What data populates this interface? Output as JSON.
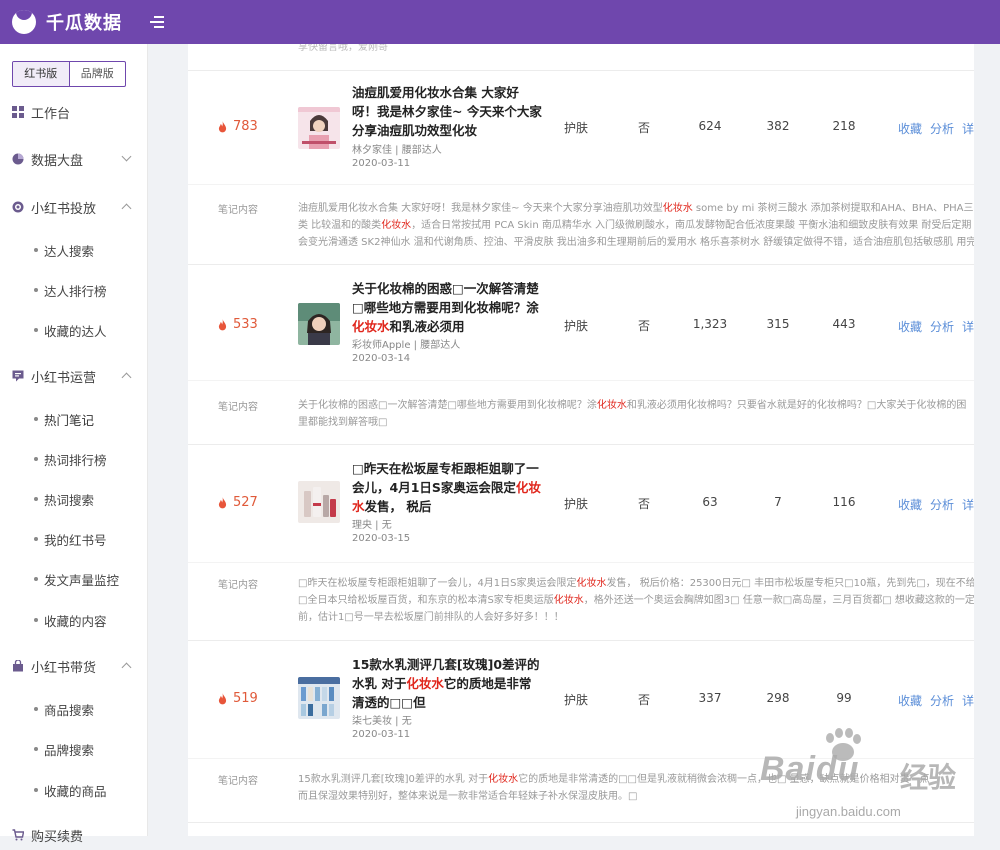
{
  "app": {
    "name": "千瓜数据"
  },
  "sidebar": {
    "versions": [
      "红书版",
      "品牌版"
    ],
    "groups": [
      {
        "label": "工作台",
        "icon": "grid-icon"
      },
      {
        "label": "数据大盘",
        "icon": "pie-icon"
      },
      {
        "label": "小红书投放",
        "icon": "target-icon"
      },
      {
        "label": "小红书运营",
        "icon": "chat-icon"
      },
      {
        "label": "小红书带货",
        "icon": "bag-icon"
      },
      {
        "label": "购买续费",
        "icon": "cart-icon"
      }
    ],
    "items": [
      "达人搜索",
      "达人排行榜",
      "收藏的达人",
      "热门笔记",
      "热词排行榜",
      "热词搜索",
      "我的红书号",
      "发文声量监控",
      "收藏的内容",
      "商品搜索",
      "品牌搜索",
      "收藏的商品"
    ]
  },
  "top_fade": "享快留言哦，爱刚哥",
  "actions": {
    "favorite": "收藏",
    "analyze": "分析",
    "detail": "详"
  },
  "note_label": "笔记内容",
  "notes": [
    {
      "hot": "783",
      "title_a": "油痘肌爱用化妆水合集 大家好呀！我是林夕家佳~ 今天来个大家分享油痘肌功效型化妆",
      "title_hl": "",
      "title_b": "",
      "author": "林夕家佳 | 腰部达人",
      "date": "2020-03-11",
      "category": "护肤",
      "flag": "否",
      "likes": "624",
      "comments": "382",
      "collects": "218",
      "content_1a": "油痘肌爱用化妆水合集 大家好呀！我是林夕家佳~ 今天来个大家分享油痘肌功效型",
      "content_1hl": "化妆水",
      "content_1b": " some by mi 茶树三酸水 添加茶树提取和AHA、BHA、PHA三",
      "content_2a": "类 比较温和的酸类",
      "content_2hl": "化妆水",
      "content_2b": "，适合日常按拭用 PCA Skin 南瓜精华水 入门级微刷酸水，南瓜发酵物配合低浓度果酸 平衡水油和细致皮肤有效果 耐受后定期",
      "content_3": "会变光滑通透 SK2神仙水 温和代谢角质、控油、平滑皮肤 我出油多和生理期前后的爱用水 格乐喜茶树水 舒缓镇定做得不错，适合油痘肌包括敏感肌 用完"
    },
    {
      "hot": "533",
      "title_a": "关于化妆棉的困惑□一次解答清楚□哪些地方需要用到化妆棉呢？涂",
      "title_hl": "化妆水",
      "title_b": "和乳液必须用",
      "author": "彩妆师Apple | 腰部达人",
      "date": "2020-03-14",
      "category": "护肤",
      "flag": "否",
      "likes": "1,323",
      "comments": "315",
      "collects": "443",
      "content_1a": "关于化妆棉的困惑□一次解答清楚□哪些地方需要用到化妆棉呢？涂",
      "content_1hl": "化妆水",
      "content_1b": "和乳液必须用化妆棉吗？只要省水就是好的化妆棉吗？□大家关于化妆棉的困",
      "content_2a": "里都能找到解答哦□",
      "content_2hl": "",
      "content_2b": "",
      "content_3": ""
    },
    {
      "hot": "527",
      "title_a": "□昨天在松坂屋专柜跟柜姐聊了一会儿，4月1日S家奥运会限定",
      "title_hl": "化妆水",
      "title_b": "发售， 税后",
      "author": "理央 | 无",
      "date": "2020-03-15",
      "category": "护肤",
      "flag": "否",
      "likes": "63",
      "comments": "7",
      "collects": "116",
      "content_1a": "□昨天在松坂屋专柜跟柜姐聊了一会儿，4月1日S家奥运会限定",
      "content_1hl": "化妆水",
      "content_1b": "发售， 税后价格：25300日元□ 丰田市松坂屋专柜只□10瓶，先到先□，现在不给预",
      "content_2a": "□全日本只给松坂屋百货，和东京的松本清S家专柜奥运版",
      "content_2hl": "化妆水",
      "content_2b": "，格外还送一个奥运会胸牌如图3□ 任意一款□高岛屋，三月百货都□ 想收藏这款的一定",
      "content_3": "前，估计1□号一早去松坂屋门前排队的人会好多好多！！！"
    },
    {
      "hot": "519",
      "title_a": "15款水乳测评几套[玫瑰]0差评的水乳 对于",
      "title_hl": "化妆水",
      "title_b": "它的质地是非常清透的□□但",
      "author": "柒七美妆 | 无",
      "date": "2020-03-11",
      "category": "护肤",
      "flag": "否",
      "likes": "337",
      "comments": "298",
      "collects": "99",
      "content_1a": "15款水乳测评几套[玫瑰]0差评的水乳 对于",
      "content_1hl": "化妆水",
      "content_1b": "它的质地是非常清透的□□但是乳液就稍微会浓稠一点，也□ 量感，缺点就是价格相对贵一点",
      "content_2a": "而且保湿效果特别好，整体来说是一款非常适合年轻妹子补水保湿皮肤用。□",
      "content_2hl": "",
      "content_2b": "",
      "content_3": ""
    }
  ],
  "watermark": {
    "brand": "Baidu",
    "cn": "经验",
    "url": "jingyan.baidu.com"
  }
}
